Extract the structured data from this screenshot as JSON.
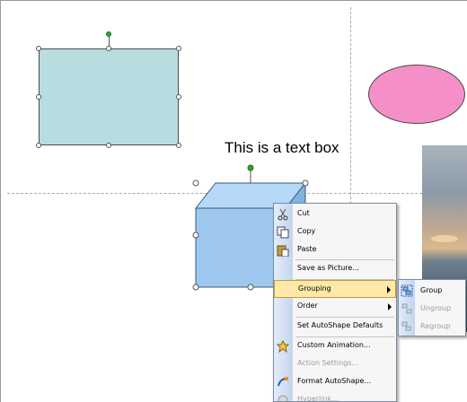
{
  "slide": {
    "textbox_text": "This is a text box"
  },
  "colors": {
    "rectangle_fill": "#b7dde1",
    "ellipse_fill": "#f58fc7",
    "cube_fill": "#9ec8ee",
    "menu_highlight": "#ffe8a8",
    "rotation_handle": "#2ea52e"
  },
  "context_menu": {
    "items": [
      {
        "label": "Cut",
        "icon": "scissors-icon",
        "enabled": true
      },
      {
        "label": "Copy",
        "icon": "copy-icon",
        "enabled": true
      },
      {
        "label": "Paste",
        "icon": "paste-icon",
        "enabled": true
      },
      {
        "label": "Save as Picture...",
        "icon": "",
        "enabled": true
      },
      {
        "label": "Grouping",
        "icon": "",
        "enabled": true,
        "submenu": true,
        "highlighted": true
      },
      {
        "label": "Order",
        "icon": "",
        "enabled": true,
        "submenu": true
      },
      {
        "label": "Set AutoShape Defaults",
        "icon": "",
        "enabled": true
      },
      {
        "label": "Custom Animation...",
        "icon": "animation-star-icon",
        "enabled": true
      },
      {
        "label": "Action Settings...",
        "icon": "",
        "enabled": false
      },
      {
        "label": "Format AutoShape...",
        "icon": "format-autoshape-icon",
        "enabled": true
      },
      {
        "label": "Hyperlink...",
        "icon": "hyperlink-globe-icon",
        "enabled": false
      }
    ]
  },
  "grouping_submenu": {
    "items": [
      {
        "label": "Group",
        "icon": "group-icon",
        "enabled": true
      },
      {
        "label": "Ungroup",
        "icon": "ungroup-icon",
        "enabled": false
      },
      {
        "label": "Regroup",
        "icon": "regroup-icon",
        "enabled": false
      }
    ]
  }
}
